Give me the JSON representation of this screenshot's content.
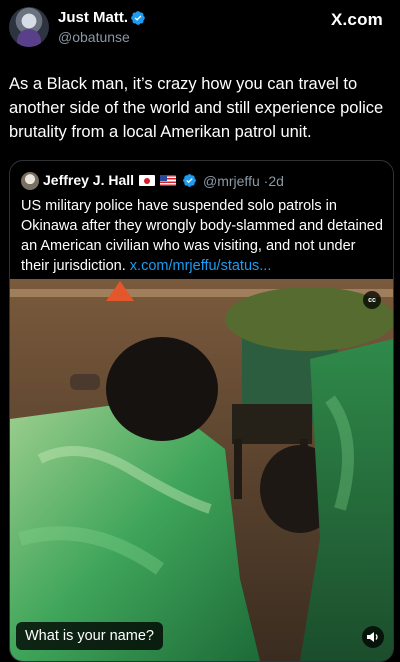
{
  "post": {
    "author_name": "Just Matt.",
    "author_handle": "@obatunse",
    "brand": "X.com",
    "text": "As a Black man, it’s crazy how you can travel to another side of the world and still experience police brutality from a local Amerikan patrol unit."
  },
  "quote": {
    "author_name": "Jeffrey J. Hall",
    "author_handle": "@mrjeffu",
    "time": "2d",
    "text": "US military police have suspended solo patrols in Okinawa after they wrongly body-slammed and detained an American civilian who was visiting, and not under their jurisdiction. ",
    "link": "x.com/mrjeffu/status..."
  },
  "media": {
    "caption": "What is your name?",
    "cc_label": "cc",
    "icons": [
      "closed-captions-icon",
      "volume-icon"
    ]
  },
  "colors": {
    "background": "#000000",
    "verified": "#1d9bf0",
    "link": "#1d9bf0",
    "muted": "#8b98a5"
  }
}
